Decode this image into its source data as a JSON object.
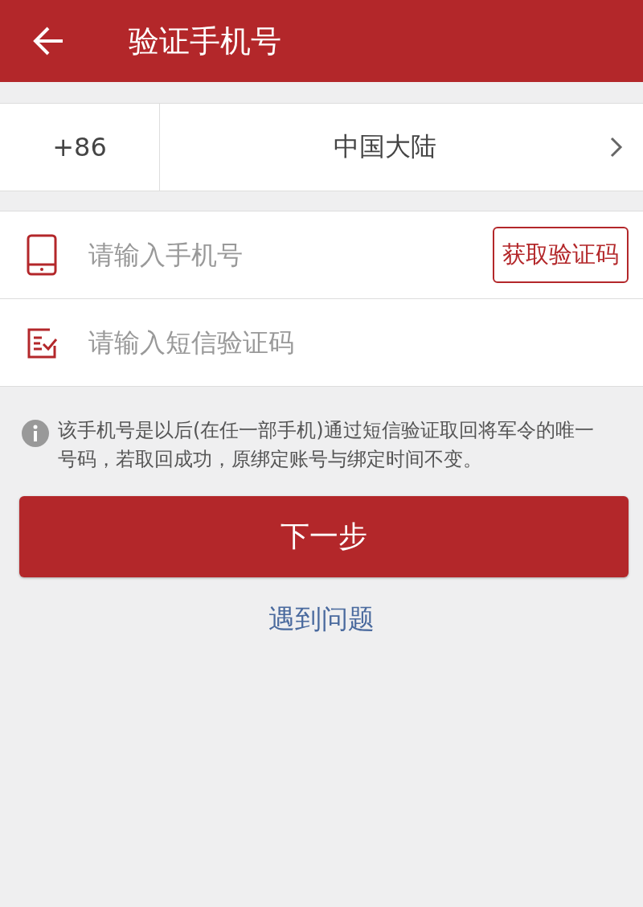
{
  "header": {
    "title": "验证手机号"
  },
  "region": {
    "code": "+86",
    "name": "中国大陆"
  },
  "phone": {
    "placeholder": "请输入手机号",
    "send_button": "获取验证码"
  },
  "sms": {
    "placeholder": "请输入短信验证码"
  },
  "notice": "该手机号是以后(在任一部手机)通过短信验证取回将军令的唯一号码，若取回成功，原绑定账号与绑定时间不变。",
  "next_button": "下一步",
  "help_link": "遇到问题"
}
